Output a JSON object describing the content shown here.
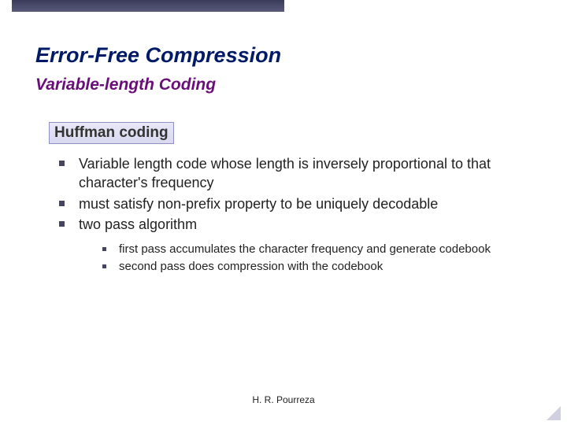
{
  "title": "Error-Free Compression",
  "subtitle": "Variable-length Coding",
  "subhead": "Huffman coding",
  "bullets": [
    "Variable length code whose length is inversely proportional to that character's frequency",
    "must satisfy non-prefix property to be uniquely decodable",
    "two pass algorithm"
  ],
  "subbullets": [
    "first pass accumulates the character frequency and generate codebook",
    "second pass does compression with the codebook"
  ],
  "footer": "H. R. Pourreza"
}
